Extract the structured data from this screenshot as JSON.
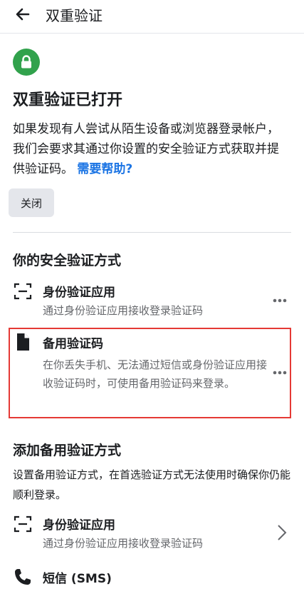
{
  "header": {
    "title": "双重验证"
  },
  "status": {
    "title": "双重验证已打开",
    "description": "如果发现有人尝试从陌生设备或浏览器登录帐户，我们会要求其通过你设置的安全验证方式获取并提供验证码。",
    "help_link": "需要帮助?",
    "close_label": "关闭",
    "badge_color": "#31a24c"
  },
  "security_methods": {
    "title": "你的安全验证方式",
    "items": [
      {
        "title": "身份验证应用",
        "description": "通过身份验证应用接收登录验证码",
        "icon": "scan-frame-icon"
      },
      {
        "title": "备用验证码",
        "description": "在你丢失手机、无法通过短信或身份验证应用接收验证码时，可使用备用验证码来登录。",
        "icon": "document-icon"
      }
    ]
  },
  "add_methods": {
    "title": "添加备用验证方式",
    "description": "设置备用验证方式，在首选验证方式无法使用时确保你仍能顺利登录。",
    "items": [
      {
        "title": "身份验证应用",
        "description": "通过身份验证应用接收登录验证码",
        "icon": "scan-frame-icon"
      },
      {
        "title": "短信 (SMS)",
        "description": "",
        "icon": "phone-icon"
      }
    ]
  },
  "colors": {
    "link": "#1b74e4",
    "highlight_border": "#e53935",
    "secondary_text": "#65676b"
  }
}
